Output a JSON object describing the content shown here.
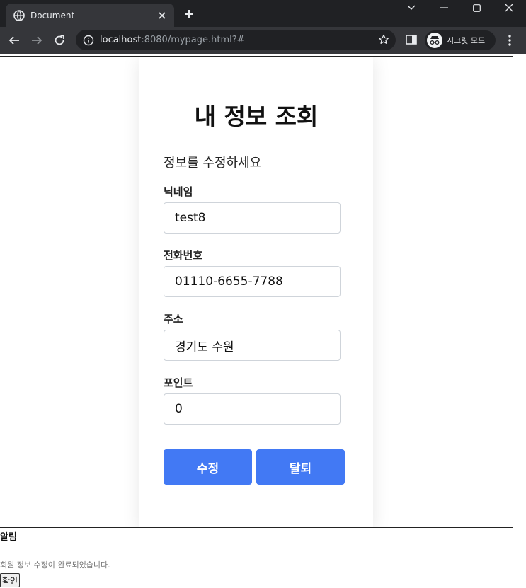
{
  "browser": {
    "tab_title": "Document",
    "url_host": "localhost",
    "url_rest": ":8080/mypage.html?#",
    "incognito_label": "시크릿 모드"
  },
  "page": {
    "heading": "내 정보 조회",
    "subtitle": "정보를 수정하세요",
    "fields": [
      {
        "label": "닉네임",
        "value": "test8"
      },
      {
        "label": "전화번호",
        "value": "01110-6655-7788"
      },
      {
        "label": "주소",
        "value": "경기도 수원"
      },
      {
        "label": "포인트",
        "value": "0"
      }
    ],
    "buttons": {
      "edit": "수정",
      "withdraw": "탈퇴"
    }
  },
  "alert": {
    "title": "알림",
    "message": "회원 정보 수정이 완료되었습니다.",
    "ok_label": "확인"
  },
  "colors": {
    "primary_button": "#4279f4",
    "chrome_dark": "#202124",
    "chrome_mid": "#35363a"
  }
}
